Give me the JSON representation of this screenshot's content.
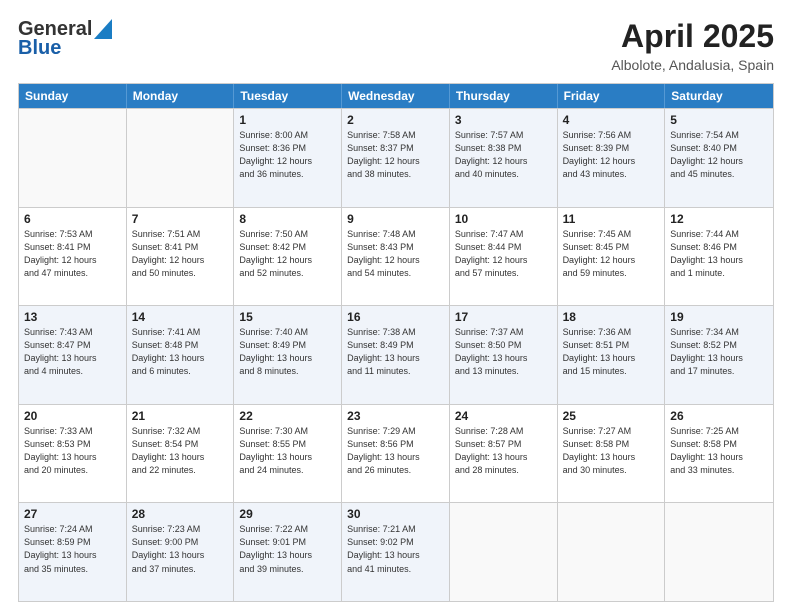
{
  "header": {
    "logo_line1": "General",
    "logo_line2": "Blue",
    "title": "April 2025",
    "subtitle": "Albolote, Andalusia, Spain"
  },
  "days_of_week": [
    "Sunday",
    "Monday",
    "Tuesday",
    "Wednesday",
    "Thursday",
    "Friday",
    "Saturday"
  ],
  "weeks": [
    [
      {
        "day": "",
        "info": ""
      },
      {
        "day": "",
        "info": ""
      },
      {
        "day": "1",
        "info": "Sunrise: 8:00 AM\nSunset: 8:36 PM\nDaylight: 12 hours\nand 36 minutes."
      },
      {
        "day": "2",
        "info": "Sunrise: 7:58 AM\nSunset: 8:37 PM\nDaylight: 12 hours\nand 38 minutes."
      },
      {
        "day": "3",
        "info": "Sunrise: 7:57 AM\nSunset: 8:38 PM\nDaylight: 12 hours\nand 40 minutes."
      },
      {
        "day": "4",
        "info": "Sunrise: 7:56 AM\nSunset: 8:39 PM\nDaylight: 12 hours\nand 43 minutes."
      },
      {
        "day": "5",
        "info": "Sunrise: 7:54 AM\nSunset: 8:40 PM\nDaylight: 12 hours\nand 45 minutes."
      }
    ],
    [
      {
        "day": "6",
        "info": "Sunrise: 7:53 AM\nSunset: 8:41 PM\nDaylight: 12 hours\nand 47 minutes."
      },
      {
        "day": "7",
        "info": "Sunrise: 7:51 AM\nSunset: 8:41 PM\nDaylight: 12 hours\nand 50 minutes."
      },
      {
        "day": "8",
        "info": "Sunrise: 7:50 AM\nSunset: 8:42 PM\nDaylight: 12 hours\nand 52 minutes."
      },
      {
        "day": "9",
        "info": "Sunrise: 7:48 AM\nSunset: 8:43 PM\nDaylight: 12 hours\nand 54 minutes."
      },
      {
        "day": "10",
        "info": "Sunrise: 7:47 AM\nSunset: 8:44 PM\nDaylight: 12 hours\nand 57 minutes."
      },
      {
        "day": "11",
        "info": "Sunrise: 7:45 AM\nSunset: 8:45 PM\nDaylight: 12 hours\nand 59 minutes."
      },
      {
        "day": "12",
        "info": "Sunrise: 7:44 AM\nSunset: 8:46 PM\nDaylight: 13 hours\nand 1 minute."
      }
    ],
    [
      {
        "day": "13",
        "info": "Sunrise: 7:43 AM\nSunset: 8:47 PM\nDaylight: 13 hours\nand 4 minutes."
      },
      {
        "day": "14",
        "info": "Sunrise: 7:41 AM\nSunset: 8:48 PM\nDaylight: 13 hours\nand 6 minutes."
      },
      {
        "day": "15",
        "info": "Sunrise: 7:40 AM\nSunset: 8:49 PM\nDaylight: 13 hours\nand 8 minutes."
      },
      {
        "day": "16",
        "info": "Sunrise: 7:38 AM\nSunset: 8:49 PM\nDaylight: 13 hours\nand 11 minutes."
      },
      {
        "day": "17",
        "info": "Sunrise: 7:37 AM\nSunset: 8:50 PM\nDaylight: 13 hours\nand 13 minutes."
      },
      {
        "day": "18",
        "info": "Sunrise: 7:36 AM\nSunset: 8:51 PM\nDaylight: 13 hours\nand 15 minutes."
      },
      {
        "day": "19",
        "info": "Sunrise: 7:34 AM\nSunset: 8:52 PM\nDaylight: 13 hours\nand 17 minutes."
      }
    ],
    [
      {
        "day": "20",
        "info": "Sunrise: 7:33 AM\nSunset: 8:53 PM\nDaylight: 13 hours\nand 20 minutes."
      },
      {
        "day": "21",
        "info": "Sunrise: 7:32 AM\nSunset: 8:54 PM\nDaylight: 13 hours\nand 22 minutes."
      },
      {
        "day": "22",
        "info": "Sunrise: 7:30 AM\nSunset: 8:55 PM\nDaylight: 13 hours\nand 24 minutes."
      },
      {
        "day": "23",
        "info": "Sunrise: 7:29 AM\nSunset: 8:56 PM\nDaylight: 13 hours\nand 26 minutes."
      },
      {
        "day": "24",
        "info": "Sunrise: 7:28 AM\nSunset: 8:57 PM\nDaylight: 13 hours\nand 28 minutes."
      },
      {
        "day": "25",
        "info": "Sunrise: 7:27 AM\nSunset: 8:58 PM\nDaylight: 13 hours\nand 30 minutes."
      },
      {
        "day": "26",
        "info": "Sunrise: 7:25 AM\nSunset: 8:58 PM\nDaylight: 13 hours\nand 33 minutes."
      }
    ],
    [
      {
        "day": "27",
        "info": "Sunrise: 7:24 AM\nSunset: 8:59 PM\nDaylight: 13 hours\nand 35 minutes."
      },
      {
        "day": "28",
        "info": "Sunrise: 7:23 AM\nSunset: 9:00 PM\nDaylight: 13 hours\nand 37 minutes."
      },
      {
        "day": "29",
        "info": "Sunrise: 7:22 AM\nSunset: 9:01 PM\nDaylight: 13 hours\nand 39 minutes."
      },
      {
        "day": "30",
        "info": "Sunrise: 7:21 AM\nSunset: 9:02 PM\nDaylight: 13 hours\nand 41 minutes."
      },
      {
        "day": "",
        "info": ""
      },
      {
        "day": "",
        "info": ""
      },
      {
        "day": "",
        "info": ""
      }
    ]
  ]
}
